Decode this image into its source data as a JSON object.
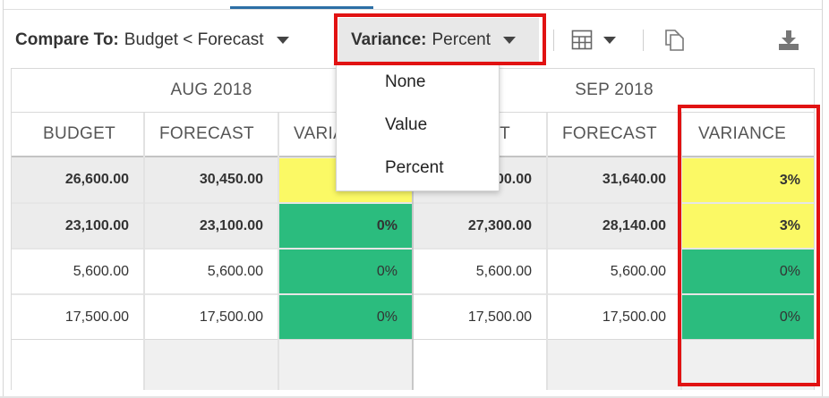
{
  "toolbar": {
    "compare_label": "Compare To:",
    "compare_value": "Budget < Forecast",
    "variance_label": "Variance:",
    "variance_value": "Percent"
  },
  "dropdown": {
    "options": [
      "None",
      "Value",
      "Percent"
    ],
    "selected": "Percent"
  },
  "grid": {
    "periods": [
      "AUG 2018",
      "SEP 2018"
    ],
    "columns": [
      "BUDGET",
      "FORECAST",
      "VARIANCE"
    ],
    "aug": {
      "budget_header": "BUDGET",
      "forecast_header": "FORECAST",
      "variance_header_visible": "VARIA",
      "rows": [
        {
          "budget": "26,600.00",
          "forecast": "30,450.00",
          "variance": ""
        },
        {
          "budget": "23,100.00",
          "forecast": "23,100.00",
          "variance": "0%"
        },
        {
          "budget": "5,600.00",
          "forecast": "5,600.00",
          "variance": "0%"
        },
        {
          "budget": "17,500.00",
          "forecast": "17,500.00",
          "variance": "0%"
        }
      ]
    },
    "sep": {
      "budget_header_visible": "T",
      "forecast_header": "FORECAST",
      "variance_header": "VARIANCE",
      "rows": [
        {
          "budget": "00.00",
          "forecast": "31,640.00",
          "variance": "3%"
        },
        {
          "budget": "27,300.00",
          "forecast": "28,140.00",
          "variance": "3%"
        },
        {
          "budget": "5,600.00",
          "forecast": "5,600.00",
          "variance": "0%"
        },
        {
          "budget": "17,500.00",
          "forecast": "17,500.00",
          "variance": "0%"
        }
      ]
    }
  },
  "colors": {
    "highlight": "#e11212",
    "variance_yellow": "#fbf965",
    "variance_green": "#2bbc7e",
    "bold_row_bg": "#ececec",
    "accent": "#2c6fa6"
  },
  "icons": [
    "chevron-down-icon",
    "table-layout-icon",
    "copy-icon",
    "download-icon"
  ]
}
